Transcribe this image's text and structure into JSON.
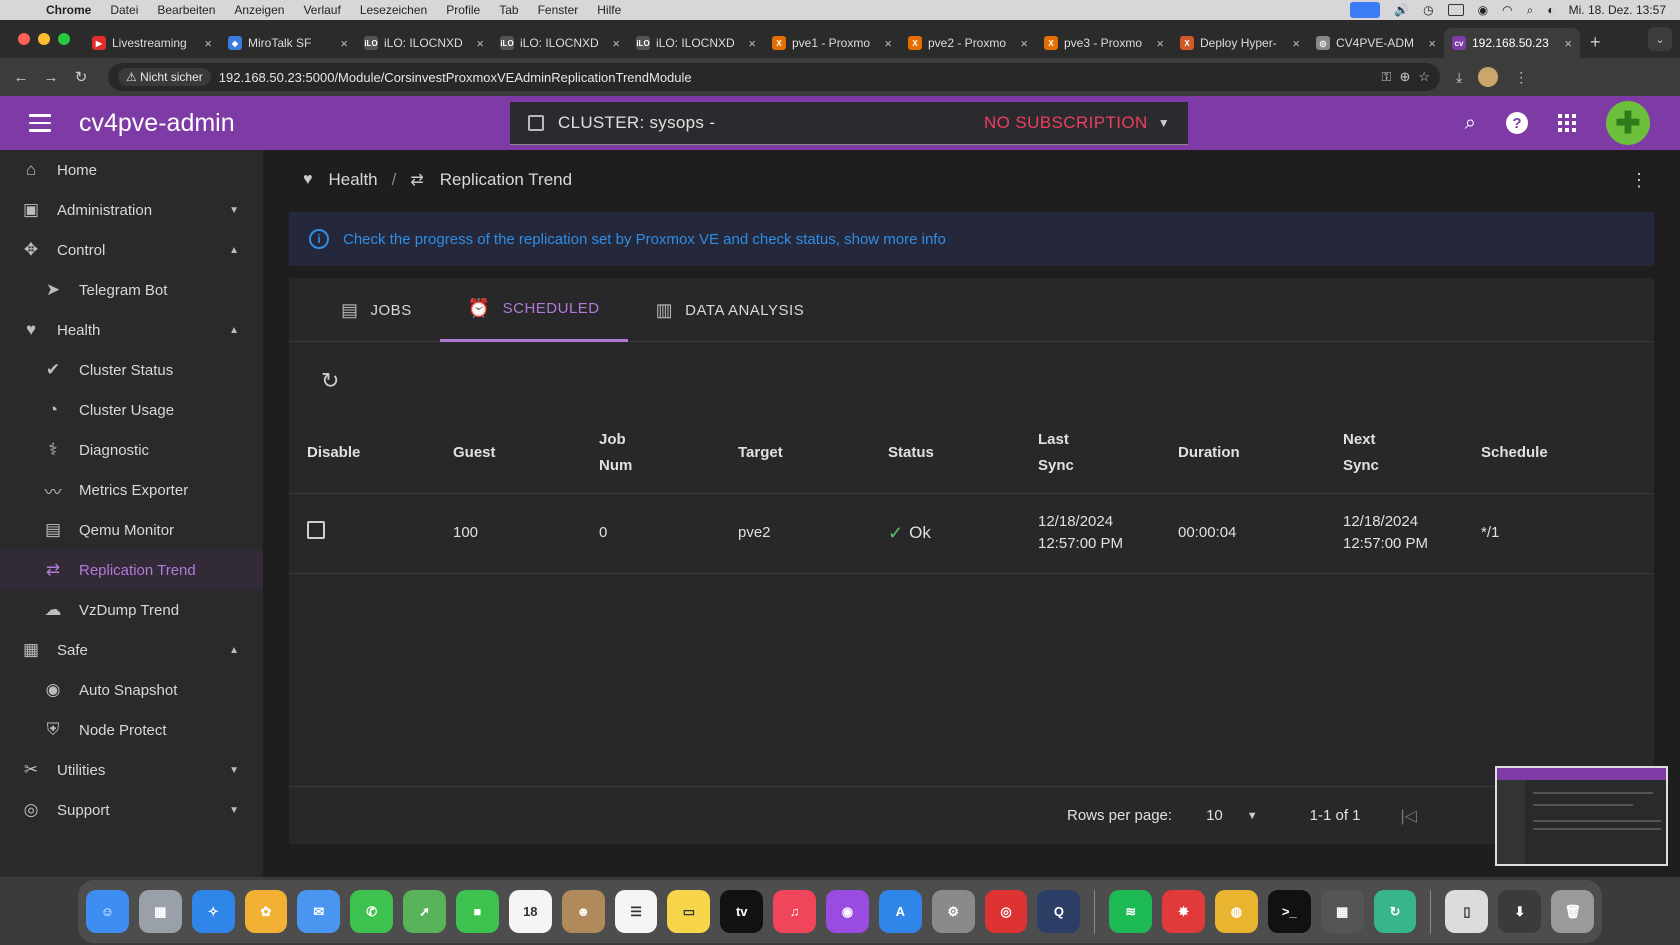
{
  "menubar": {
    "app": "Chrome",
    "items": [
      "Datei",
      "Bearbeiten",
      "Anzeigen",
      "Verlauf",
      "Lesezeichen",
      "Profile",
      "Tab",
      "Fenster",
      "Hilfe"
    ],
    "clock": "Mi. 18. Dez. 13:57"
  },
  "browser": {
    "tabs": [
      {
        "title": "Livestreaming",
        "color": "#e02d2d",
        "fav": "▶"
      },
      {
        "title": "MiroTalk SF",
        "color": "#3a7be0",
        "fav": "◆"
      },
      {
        "title": "iLO: ILOCNXD",
        "color": "#555555",
        "fav": "iLO"
      },
      {
        "title": "iLO: ILOCNXD",
        "color": "#555555",
        "fav": "iLO"
      },
      {
        "title": "iLO: ILOCNXD",
        "color": "#555555",
        "fav": "iLO"
      },
      {
        "title": "pve1 - Proxmo",
        "color": "#e57000",
        "fav": "X"
      },
      {
        "title": "pve2 - Proxmo",
        "color": "#e57000",
        "fav": "X"
      },
      {
        "title": "pve3 - Proxmo",
        "color": "#e57000",
        "fav": "X"
      },
      {
        "title": "Deploy Hyper-",
        "color": "#d05a2a",
        "fav": "X"
      },
      {
        "title": "CV4PVE-ADM",
        "color": "#888888",
        "fav": "◎"
      },
      {
        "title": "192.168.50.23",
        "color": "#7e3aa5",
        "fav": "cv"
      }
    ],
    "security": "Nicht sicher",
    "url": "192.168.50.23:5000/Module/CorsinvestProxmoxVEAdminReplicationTrendModule"
  },
  "app": {
    "brand": "cv4pve-admin",
    "cluster": "CLUSTER: sysops -",
    "subscription": "NO SUBSCRIPTION"
  },
  "sidebar": {
    "items": [
      {
        "label": "Home",
        "icon": "⌂",
        "level": 0
      },
      {
        "label": "Administration",
        "icon": "▣",
        "level": 0,
        "arrow": "▼"
      },
      {
        "label": "Control",
        "icon": "✥",
        "level": 0,
        "arrow": "▲"
      },
      {
        "label": "Telegram Bot",
        "icon": "➤",
        "level": 1
      },
      {
        "label": "Health",
        "icon": "♥",
        "level": 0,
        "arrow": "▲"
      },
      {
        "label": "Cluster Status",
        "icon": "✔",
        "level": 1
      },
      {
        "label": "Cluster Usage",
        "icon": "◔",
        "level": 1
      },
      {
        "label": "Diagnostic",
        "icon": "⚕",
        "level": 1
      },
      {
        "label": "Metrics Exporter",
        "icon": "〰",
        "level": 1
      },
      {
        "label": "Qemu Monitor",
        "icon": "▤",
        "level": 1
      },
      {
        "label": "Replication Trend",
        "icon": "⇄",
        "level": 1,
        "active": true
      },
      {
        "label": "VzDump Trend",
        "icon": "☁",
        "level": 1
      },
      {
        "label": "Safe",
        "icon": "▦",
        "level": 0,
        "arrow": "▲"
      },
      {
        "label": "Auto Snapshot",
        "icon": "◉",
        "level": 1
      },
      {
        "label": "Node Protect",
        "icon": "⛨",
        "level": 1
      },
      {
        "label": "Utilities",
        "icon": "✂",
        "level": 0,
        "arrow": "▼"
      },
      {
        "label": "Support",
        "icon": "◎",
        "level": 0,
        "arrow": "▼"
      }
    ]
  },
  "breadcrumb": {
    "parent": "Health",
    "current": "Replication Trend"
  },
  "alert": {
    "text": "Check the progress of the replication set by Proxmox VE and check status, show more info"
  },
  "tabs": {
    "jobs": "JOBS",
    "scheduled": "SCHEDULED",
    "analysis": "DATA ANALYSIS"
  },
  "table": {
    "headers": {
      "disable": "Disable",
      "guest": "Guest",
      "job_num_1": "Job",
      "job_num_2": "Num",
      "target": "Target",
      "status": "Status",
      "last_sync_1": "Last",
      "last_sync_2": "Sync",
      "duration": "Duration",
      "next_sync_1": "Next",
      "next_sync_2": "Sync",
      "schedule": "Schedule"
    },
    "rows": [
      {
        "guest": "100",
        "job_num": "0",
        "target": "pve2",
        "status": "Ok",
        "last_sync_date": "12/18/2024",
        "last_sync_time": "12:57:00 PM",
        "duration": "00:00:04",
        "next_sync_date": "12/18/2024",
        "next_sync_time": "12:57:00 PM",
        "schedule": "*/1"
      }
    ]
  },
  "pagination": {
    "rows_per_page_label": "Rows per page:",
    "rows_per_page": "10",
    "range": "1-1 of 1"
  },
  "dock": {
    "apps": [
      {
        "name": "Finder",
        "color": "#3d8ef0",
        "glyph": "☺"
      },
      {
        "name": "Launchpad",
        "color": "#9aa0a8",
        "glyph": "▦"
      },
      {
        "name": "Safari",
        "color": "#2f86e8",
        "glyph": "✧"
      },
      {
        "name": "Photos",
        "color": "#f2b134",
        "glyph": "✿"
      },
      {
        "name": "Mail",
        "color": "#4a95f0",
        "glyph": "✉"
      },
      {
        "name": "Messages",
        "color": "#3ec24f",
        "glyph": "✆"
      },
      {
        "name": "Maps",
        "color": "#59b35a",
        "glyph": "➚"
      },
      {
        "name": "FaceTime",
        "color": "#3ec24f",
        "glyph": "■"
      },
      {
        "name": "Calendar",
        "color": "#f5f5f5",
        "glyph": "18"
      },
      {
        "name": "Contacts",
        "color": "#b08a5a",
        "glyph": "☻"
      },
      {
        "name": "Reminders",
        "color": "#f5f5f5",
        "glyph": "☰"
      },
      {
        "name": "Notes",
        "color": "#f7d54a",
        "glyph": "▭"
      },
      {
        "name": "TV",
        "color": "#111111",
        "glyph": "tv"
      },
      {
        "name": "Music",
        "color": "#f0455a",
        "glyph": "♫"
      },
      {
        "name": "Podcasts",
        "color": "#9a4be0",
        "glyph": "◉"
      },
      {
        "name": "App Store",
        "color": "#2f86e8",
        "glyph": "A"
      },
      {
        "name": "System Settings",
        "color": "#8a8a8a",
        "glyph": "⚙"
      },
      {
        "name": "Lifesaver",
        "color": "#d33",
        "glyph": "◎"
      },
      {
        "name": "QuickTime",
        "color": "#2c3e66",
        "glyph": "Q"
      },
      {
        "name": "Spotify",
        "color": "#1db954",
        "glyph": "≋"
      },
      {
        "name": "Tweak",
        "color": "#e03a3a",
        "glyph": "✸"
      },
      {
        "name": "Chrome",
        "color": "#e9b531",
        "glyph": "◍"
      },
      {
        "name": "Terminal",
        "color": "#111111",
        "glyph": ">_"
      },
      {
        "name": "Calculator",
        "color": "#555555",
        "glyph": "▦"
      },
      {
        "name": "Sync",
        "color": "#39b58a",
        "glyph": "↻"
      },
      {
        "name": "Archive",
        "color": "#dcdcdc",
        "glyph": "▯"
      },
      {
        "name": "Downloads",
        "color": "#3b3b3b",
        "glyph": "⬇"
      },
      {
        "name": "Trash",
        "color": "#9a9a9a",
        "glyph": "🗑"
      }
    ]
  }
}
